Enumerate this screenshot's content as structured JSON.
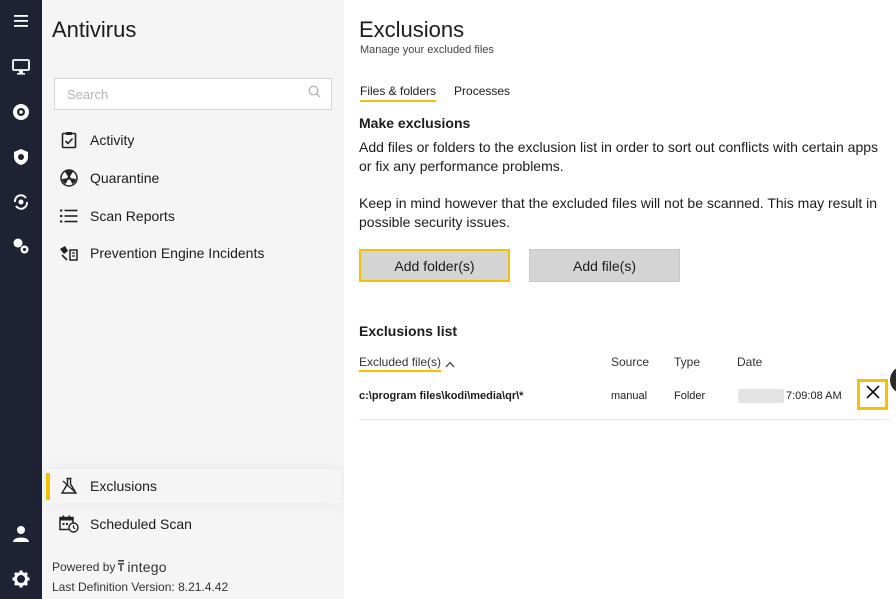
{
  "rail": {
    "icons": [
      "menu-icon",
      "monitor-icon",
      "virusbarrier-icon",
      "shield-icon",
      "sync-icon",
      "settings-group-icon",
      "user-icon",
      "gear-icon"
    ]
  },
  "sidebar": {
    "title": "Antivirus",
    "search_placeholder": "Search",
    "items": [
      {
        "label": "Activity",
        "icon": "clipboard-icon"
      },
      {
        "label": "Quarantine",
        "icon": "radiation-icon"
      },
      {
        "label": "Scan Reports",
        "icon": "list-icon"
      },
      {
        "label": "Prevention Engine Incidents",
        "icon": "incident-icon"
      }
    ],
    "bottom_items": [
      {
        "label": "Exclusions",
        "icon": "flask-icon",
        "active": true
      },
      {
        "label": "Scheduled Scan",
        "icon": "calendar-clock-icon"
      }
    ],
    "powered_by": "Powered by",
    "brand": "intego",
    "definition": "Last Definition Version: 8.21.4.42"
  },
  "main": {
    "title": "Exclusions",
    "subtitle": "Manage your excluded files",
    "tabs": [
      "Files & folders",
      "Processes"
    ],
    "make_title": "Make exclusions",
    "para1": "Add files or folders to the exclusion list in order to sort out conflicts with certain apps or fix any performance problems.",
    "para2": "Keep in mind however that the excluded files will not be scanned. This may result in possible security issues.",
    "add_folder": "Add folder(s)",
    "add_file": "Add file(s)",
    "list_title": "Exclusions list",
    "columns": {
      "file": "Excluded file(s)",
      "source": "Source",
      "type": "Type",
      "date": "Date"
    },
    "rows": [
      {
        "path": "c:\\program files\\kodi\\media\\qr\\*",
        "source": "manual",
        "type": "Folder",
        "time": "7:09:08 AM"
      }
    ]
  },
  "colors": {
    "accent": "#f2c200",
    "rail": "#1f2233",
    "sidebar": "#f5f5f5"
  }
}
